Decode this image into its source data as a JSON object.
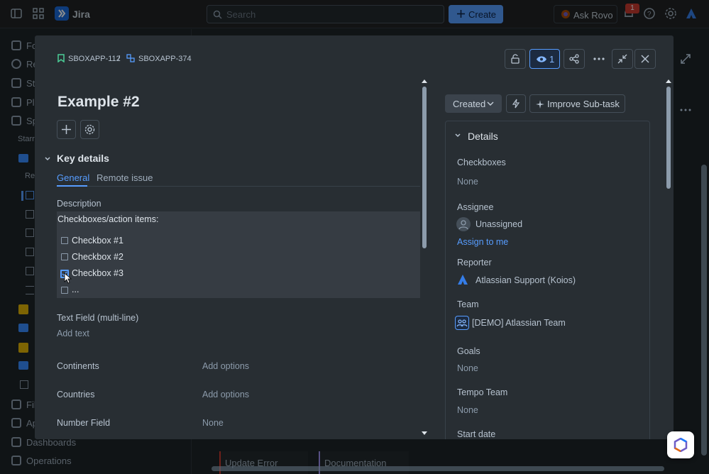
{
  "topbar": {
    "app_name": "Jira",
    "search_placeholder": "Search",
    "create_label": "Create",
    "ask_rovo_label": "Ask Rovo",
    "notification_count": "1"
  },
  "sidebar": {
    "items": [
      {
        "label": "Fo"
      },
      {
        "label": "Re"
      },
      {
        "label": "St"
      },
      {
        "label": "Pl"
      },
      {
        "label": "Sp"
      },
      {
        "label": "Starr"
      },
      {
        "label": "Re"
      },
      {
        "label": "Fil"
      },
      {
        "label": "Ap"
      },
      {
        "label": "Dashboards"
      },
      {
        "label": "Operations"
      }
    ]
  },
  "background": {
    "cards": [
      "Update Error",
      "Documentation"
    ]
  },
  "modal": {
    "breadcrumb": {
      "parent": "SBOXAPP-112",
      "separator": "/",
      "current": "SBOXAPP-374"
    },
    "watch_count": "1",
    "title": "Example #2",
    "key_details_title": "Key details",
    "tabs": [
      {
        "label": "General",
        "active": true
      },
      {
        "label": "Remote issue",
        "active": false
      }
    ],
    "description": {
      "label": "Description",
      "heading": "Checkboxes/action items:",
      "items": [
        {
          "text": "Checkbox #1",
          "checked": false
        },
        {
          "text": "Checkbox #2",
          "checked": false
        },
        {
          "text": "Checkbox #3",
          "checked": true
        },
        {
          "text": "...",
          "checked": false
        }
      ]
    },
    "text_field": {
      "label": "Text Field (multi-line)",
      "placeholder": "Add text"
    },
    "fields": [
      {
        "label": "Continents",
        "value": "Add options"
      },
      {
        "label": "Countries",
        "value": "Add options"
      },
      {
        "label": "Number Field",
        "value": "None"
      }
    ],
    "status_label": "Created",
    "improve_label": "Improve Sub-task",
    "details": {
      "title": "Details",
      "checkboxes": {
        "label": "Checkboxes",
        "value": "None"
      },
      "assignee": {
        "label": "Assignee",
        "value": "Unassigned",
        "action": "Assign to me"
      },
      "reporter": {
        "label": "Reporter",
        "value": "Atlassian Support (Koios)"
      },
      "team": {
        "label": "Team",
        "value": "[DEMO] Atlassian Team"
      },
      "goals": {
        "label": "Goals",
        "value": "None"
      },
      "tempo_team": {
        "label": "Tempo Team",
        "value": "None"
      },
      "start_date": {
        "label": "Start date"
      }
    }
  },
  "colors": {
    "accent": "#579dff",
    "background": "#1d2125",
    "modal": "#282e33"
  }
}
